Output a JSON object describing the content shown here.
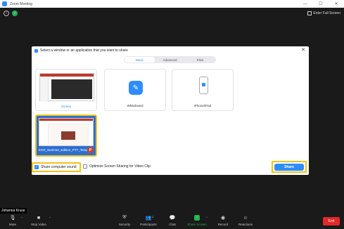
{
  "window": {
    "title": "Zoom Meeting"
  },
  "top_bar": {
    "fullscreen_label": "Enter Full Screen"
  },
  "dialog": {
    "title": "Select a window or an application that you want to share",
    "tabs": [
      {
        "label": "Basic",
        "active": true
      },
      {
        "label": "Advanced",
        "active": false
      },
      {
        "label": "Files",
        "active": false
      }
    ],
    "tiles": [
      {
        "label": "Screen",
        "icon": "monitor-preview"
      },
      {
        "label": "Whiteboard",
        "icon": "pencil-icon"
      },
      {
        "label": "iPhone/iPad",
        "icon": "phone-icon"
      },
      {
        "label": "ECR_Summer_Edition_PTT_Templ...",
        "icon": "powerpoint-icon"
      }
    ],
    "share_sound_label": "Share computer sound",
    "share_sound_checked": true,
    "optimize_label": "Optimize Screen Sharing for Video Clip",
    "optimize_checked": false,
    "share_button": "Share"
  },
  "participant_name": "Johanna Kruse",
  "toolbar": {
    "mute": "Mute",
    "stop_video": "Stop Video",
    "security": "Security",
    "participants": "Participants",
    "participants_count": "1",
    "chat": "Chat",
    "share_screen": "Share Screen",
    "record": "Record",
    "reactions": "Reactions",
    "end": "End"
  },
  "colors": {
    "accent": "#2d8cff",
    "highlight": "#f0c419",
    "end": "#e02828",
    "share_green": "#1fb34e"
  }
}
